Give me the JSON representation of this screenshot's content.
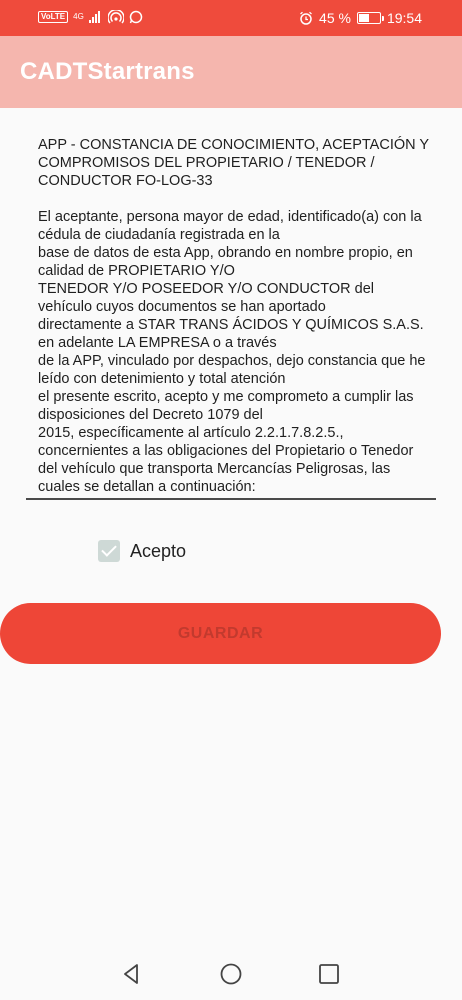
{
  "status_bar": {
    "network_badge": "VoLTE",
    "network_type": "4G",
    "battery_percent": "45 %",
    "battery_level": 0.45,
    "time": "19:54"
  },
  "app_bar": {
    "title": "CADTStartrans"
  },
  "terms": {
    "title": "APP - CONSTANCIA DE CONOCIMIENTO, ACEPTACIÓN Y COMPROMISOS DEL PROPIETARIO / TENEDOR / CONDUCTOR FO-LOG-33",
    "body": "El aceptante, persona mayor de edad, identificado(a) con la cédula de ciudadanía registrada en la\nbase de datos de esta App, obrando en nombre propio, en calidad de PROPIETARIO Y/O\nTENEDOR Y/O POSEEDOR Y/O CONDUCTOR del vehículo cuyos documentos se han aportado\ndirectamente a STAR TRANS ÁCIDOS Y QUÍMICOS S.A.S. en adelante LA EMPRESA o a través\nde la APP, vinculado por despachos, dejo constancia que he leído con detenimiento y total atención\nel presente escrito, acepto y me comprometo a cumplir las disposiciones del Decreto 1079 del\n2015, específicamente al artículo 2.2.1.7.8.2.5., concernientes a las obligaciones del Propietario o Tenedor del vehículo que transporta Mercancías Peligrosas, las cuales se detallan a continuación:"
  },
  "accept": {
    "label": "Acepto",
    "checked": true
  },
  "save_button": {
    "label": "GUARDAR"
  },
  "nav_bar": {
    "back_icon": "triangle-back-icon",
    "home_icon": "circle-home-icon",
    "recents_icon": "square-recents-icon"
  },
  "colors": {
    "status_bar": "#ef4b3c",
    "app_bar": "#f5b6ae",
    "button": "#ee4637",
    "button_text": "#c23a2e",
    "checkbox": "#ced9d6"
  }
}
